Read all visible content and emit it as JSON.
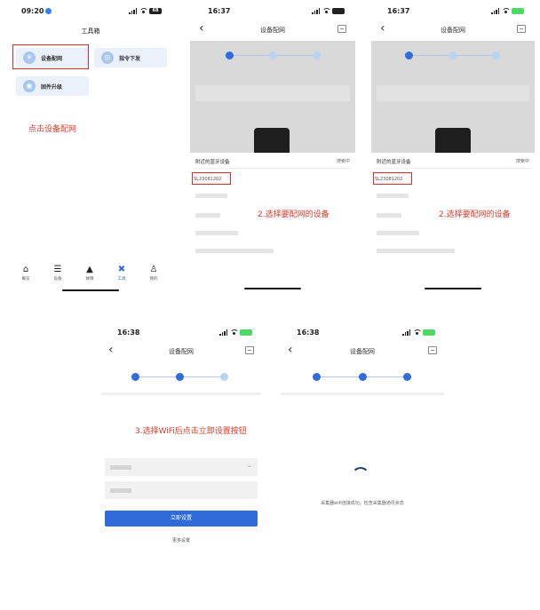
{
  "screen1": {
    "status_time": "09:20",
    "battery": "68",
    "title": "工具箱",
    "cards": [
      {
        "label": "设备配网",
        "icon": "wifi-config-icon"
      },
      {
        "label": "指令下发",
        "icon": "command-icon"
      },
      {
        "label": "固件升级",
        "icon": "firmware-icon"
      }
    ],
    "note": "点击设备配网",
    "tabs": [
      {
        "label": "概览",
        "icon": "home-icon"
      },
      {
        "label": "设备",
        "icon": "device-icon"
      },
      {
        "label": "故障",
        "icon": "warning-icon"
      },
      {
        "label": "工具",
        "icon": "tools-icon"
      },
      {
        "label": "我的",
        "icon": "user-icon"
      }
    ]
  },
  "screen2": {
    "status_time": "16:37",
    "title": "设备配网",
    "sheet_title": "附近的蓝牙设备",
    "sheet_status": "搜索中",
    "device_id": "SL23081202",
    "note": "2.选择要配网的设备"
  },
  "screen3": {
    "status_time": "16:37",
    "title": "设备配网",
    "sheet_title": "附近的蓝牙设备",
    "sheet_status": "搜索中",
    "device_id": "SL23081202",
    "note": "2.选择要配网的设备"
  },
  "screen4": {
    "status_time": "16:38",
    "title": "设备配网",
    "note": "3.选择WiFi后点击立即设置按钮",
    "button": "立即设置",
    "more": "更多设置"
  },
  "screen5": {
    "status_time": "16:38",
    "title": "设备配网",
    "message": "采集器wifi连接成功，检查采集器通讯状态"
  },
  "colors": {
    "primary": "#2f6bd9",
    "annotation": "#e0392b",
    "card_bg": "#eaf1fb"
  }
}
